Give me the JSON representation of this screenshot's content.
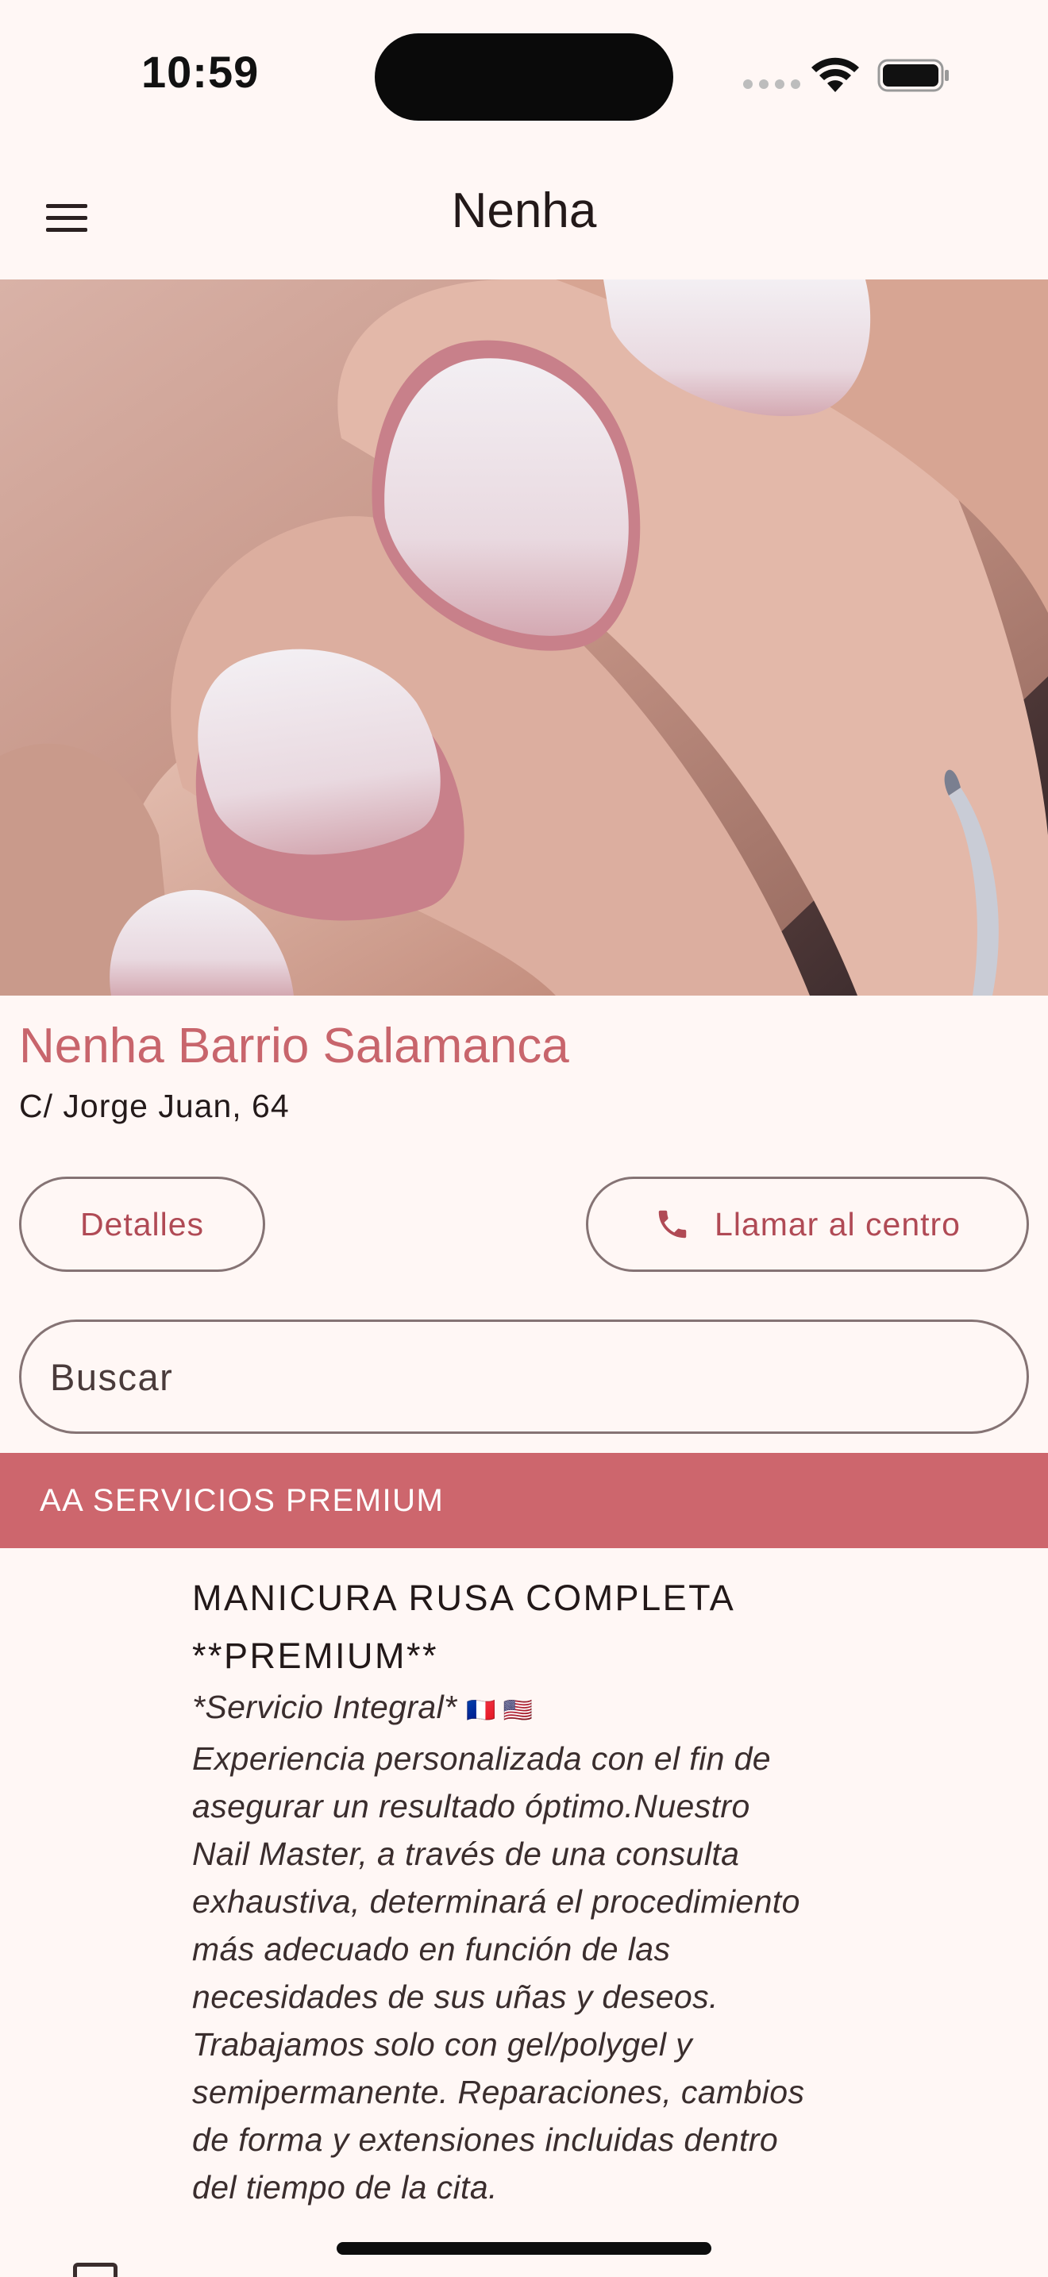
{
  "status_bar": {
    "time": "10:59"
  },
  "app_bar": {
    "title": "Nenha",
    "menu_icon": "menu-icon"
  },
  "hero": {
    "image_alt": "close-up of manicured nails with white gradient polish"
  },
  "center": {
    "name": "Nenha Barrio Salamanca",
    "address": "C/ Jorge Juan, 64"
  },
  "actions": {
    "details_label": "Detalles",
    "call_label": "Llamar al centro",
    "call_icon": "phone-icon"
  },
  "search": {
    "placeholder": "Buscar"
  },
  "category": {
    "title": "AA SERVICIOS PREMIUM"
  },
  "service": {
    "title": "MANICURA RUSA COMPLETA **PREMIUM**",
    "subtitle": "*Servicio Integral*",
    "flags": "🇫🇷 🇺🇸",
    "description": "Experiencia personalizada con el fin de asegurar un resultado óptimo.Nuestro Nail Master, a través de una consulta exhaustiva, determinará el procedimiento más adecuado en función de las necesidades de sus uñas y deseos. Trabajamos solo con gel/polygel y semipermanente. Reparaciones, cambios de forma y extensiones incluidas dentro del tiempo de la cita."
  },
  "colors": {
    "background": "#FFF7F5",
    "accent": "#CD666D",
    "accent_text": "#C8656C",
    "outline": "#857374"
  }
}
